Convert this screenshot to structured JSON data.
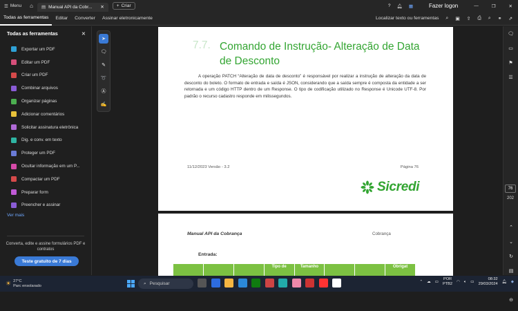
{
  "titlebar": {
    "menu_label": "Menu",
    "tab_title": "Manual API da Cobr...",
    "new_tab_label": "Criar",
    "login_label": "Fazer logon"
  },
  "toolbar": {
    "items": [
      "Todas as ferramentas",
      "Editar",
      "Converter",
      "Assinar eletronicamente"
    ],
    "search_label": "Localizar texto ou ferramentas"
  },
  "sidebar": {
    "title": "Todas as ferramentas",
    "items": [
      {
        "label": "Exportar um PDF",
        "color": "#2fa1d6"
      },
      {
        "label": "Editar um PDF",
        "color": "#d64f7a"
      },
      {
        "label": "Criar um PDF",
        "color": "#d64a4a"
      },
      {
        "label": "Combinar arquivos",
        "color": "#8a5cd6"
      },
      {
        "label": "Organizar páginas",
        "color": "#4caf50"
      },
      {
        "label": "Adicionar comentários",
        "color": "#e8c13a"
      },
      {
        "label": "Solicitar assinatura eletrônica",
        "color": "#b06ad6"
      },
      {
        "label": "Dig. e conv. em texto",
        "color": "#2fb5a3"
      },
      {
        "label": "Proteger um PDF",
        "color": "#6a7bd6"
      },
      {
        "label": "Ocultar informação em um P...",
        "color": "#d64aa8"
      },
      {
        "label": "Compactar um PDF",
        "color": "#d64a4a"
      },
      {
        "label": "Preparar form",
        "color": "#c05ad6"
      },
      {
        "label": "Preencher e assinar",
        "color": "#8a5cd6"
      }
    ],
    "more_label": "Ver mais",
    "promo_text": "Converta, edite e assine formulários PDF e contratos",
    "trial_button": "Teste gratuito de 7 dias"
  },
  "document": {
    "page1": {
      "section_number": "7.7.",
      "section_title": "Comando de Instrução- Alteração de Data de Desconto",
      "paragraph": "A operação PATCH “Alteração de data de desconto” é responsável por realizar a instrução de alteração da data de desconto do boleto. O formato de entrada e saída é JSON, considerando que a saída sempre é composta da entidade a ser retornada e um código HTTP dentro de um Response. O tipo de codificação utilizado no Response é Unicode UTF-8. Por padrão o recurso cadastro responde em milissegundos.",
      "footer_left": "11/12/2023 Versão - 3.2",
      "footer_right": "Página 76",
      "logo_text": "Sicredi"
    },
    "page2": {
      "title": "Manual API da Cobrança",
      "header_right": "Cobrança",
      "section_label": "Entrada:",
      "table_headers": [
        "",
        "",
        "",
        "Tipo de",
        "Tamanho",
        "",
        "",
        "Obrigat"
      ]
    }
  },
  "page_nav": {
    "current": "76",
    "total": "202"
  },
  "taskbar": {
    "temperature": "27°C",
    "weather": "Parc ensolarado",
    "search_placeholder": "Pesquisar",
    "lang_top": "POR",
    "lang_bottom": "PTB2",
    "time": "08:32",
    "date": "29/03/2024"
  }
}
